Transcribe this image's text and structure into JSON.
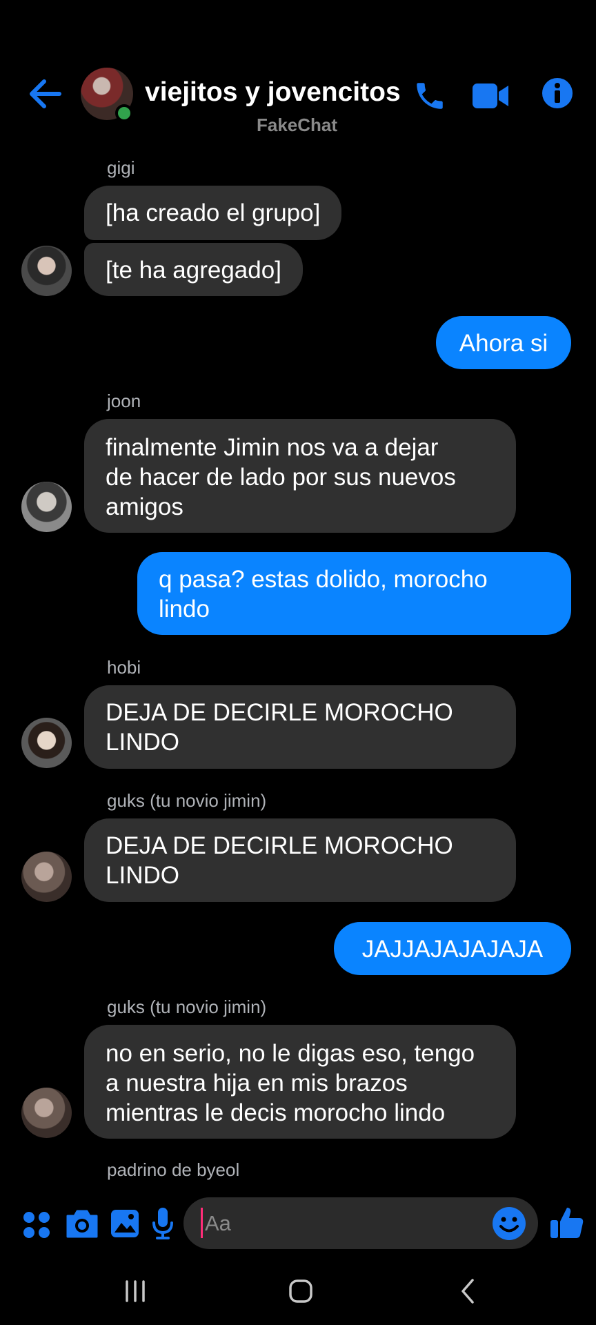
{
  "header": {
    "title": "viejitos y jovencitos",
    "subtitle": "FakeChat",
    "back_icon": "arrow-left-icon",
    "call_icon": "phone-icon",
    "video_icon": "video-camera-icon",
    "info_icon": "info-icon"
  },
  "colors": {
    "accent": "#0a84ff",
    "incoming_bubble": "#303030",
    "online": "#31a24c",
    "background": "#000000"
  },
  "messages": [
    {
      "sender": "gigi",
      "text": [
        "[ha creado el grupo]"
      ],
      "direction": "in"
    },
    {
      "sender": "",
      "text": [
        "[te ha agregado]"
      ],
      "direction": "in"
    },
    {
      "sender": "",
      "text": [
        "Ahora si"
      ],
      "direction": "out"
    },
    {
      "sender": "joon",
      "text": [
        "finalmente Jimin nos va a dejar",
        "de hacer de lado por sus nuevos",
        "amigos"
      ],
      "direction": "in"
    },
    {
      "sender": "",
      "text": [
        "q pasa? estas dolido, morocho",
        "lindo"
      ],
      "direction": "out"
    },
    {
      "sender": "hobi",
      "text": [
        "DEJA DE DECIRLE MOROCHO",
        "LINDO"
      ],
      "direction": "in"
    },
    {
      "sender": "guks (tu novio jimin)",
      "text": [
        "DEJA DE DECIRLE MOROCHO",
        "LINDO"
      ],
      "direction": "in"
    },
    {
      "sender": "",
      "text": [
        "JAJJAJAJAJAJA"
      ],
      "direction": "out"
    },
    {
      "sender": "guks (tu novio jimin)",
      "text": [
        "no en serio, no le digas eso, tengo",
        "a nuestra hija en mis brazos",
        "mientras le decis morocho lindo"
      ],
      "direction": "in"
    },
    {
      "sender": "padrino de byeol",
      "text": [],
      "direction": "in"
    }
  ],
  "composer": {
    "placeholder": "Aa",
    "icons": [
      "apps-icon",
      "camera-icon",
      "image-icon",
      "microphone-icon",
      "emoji-icon",
      "thumbs-up-icon"
    ]
  },
  "navbar": {
    "icons": [
      "recents-icon",
      "home-icon",
      "back-icon"
    ]
  }
}
